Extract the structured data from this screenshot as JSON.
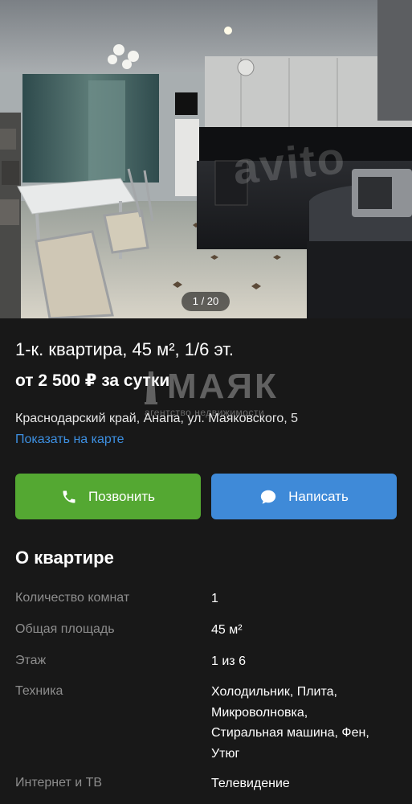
{
  "photo": {
    "counter": "1 / 20",
    "watermark": "avito"
  },
  "listing": {
    "title": "1-к. квартира, 45 м², 1/6 эт.",
    "price": "от 2 500 ₽ за сутки",
    "address": "Краснодарский край, Анапа, ул. Маяковского, 5",
    "map_link": "Показать на карте"
  },
  "brand_watermark": {
    "name": "МАЯК",
    "subtitle": "агентство недвижимости"
  },
  "actions": {
    "call_label": "Позвонить",
    "call_color": "#54a832",
    "write_label": "Написать",
    "write_color": "#3f8ad8"
  },
  "about": {
    "title": "О квартире",
    "specs": [
      {
        "label": "Количество комнат",
        "lines": [
          "1"
        ]
      },
      {
        "label": "Общая площадь",
        "lines": [
          "45 м²"
        ]
      },
      {
        "label": "Этаж",
        "lines": [
          "1 из 6"
        ]
      },
      {
        "label": "Техника",
        "lines": [
          "Холодильник, Плита,",
          "Микроволновка,",
          "Стиральная машина, Фен,",
          "Утюг"
        ]
      },
      {
        "label": "Интернет и ТВ",
        "lines": [
          "Телевидение"
        ]
      }
    ]
  },
  "colors": {
    "background": "#181818",
    "link": "#3d8fe0",
    "label_gray": "#8d8d8d"
  }
}
